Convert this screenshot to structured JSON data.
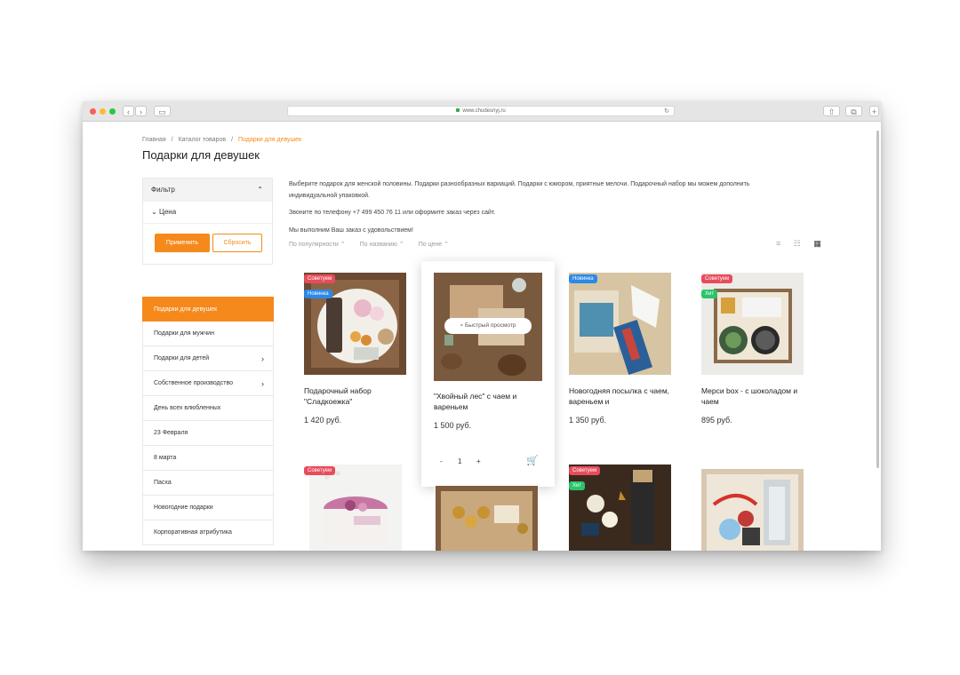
{
  "browser": {
    "url": "www.chudesnyj.ru",
    "back_glyph": "‹",
    "forward_glyph": "›",
    "sidebar_glyph": "▭",
    "reload_glyph": "↻",
    "share_glyph": "⇧",
    "tabs_glyph": "⧉",
    "newtab_glyph": "+"
  },
  "breadcrumb": {
    "items": [
      "Главная",
      "Каталог товаров",
      "Подарки для девушек"
    ],
    "separator": "/"
  },
  "page_title": "Подарки для девушек",
  "filter": {
    "title": "Фильтр",
    "collapse_glyph": "⌃",
    "price_label": "Цена",
    "price_glyph": "⌄",
    "apply_label": "Применить",
    "reset_label": "Сбросить"
  },
  "categories": [
    {
      "label": "Подарки для девушек",
      "active": true,
      "arrow": ""
    },
    {
      "label": "Подарки для мужчин",
      "active": false,
      "arrow": ""
    },
    {
      "label": "Подарки для детей",
      "active": false,
      "arrow": "›"
    },
    {
      "label": "Собственное производство",
      "active": false,
      "arrow": "›"
    },
    {
      "label": "День всех влюбленных",
      "active": false,
      "arrow": ""
    },
    {
      "label": "23 Февраля",
      "active": false,
      "arrow": ""
    },
    {
      "label": "8 марта",
      "active": false,
      "arrow": ""
    },
    {
      "label": "Пасха",
      "active": false,
      "arrow": ""
    },
    {
      "label": "Новогодние подарки",
      "active": false,
      "arrow": ""
    },
    {
      "label": "Корпоративная атрибутика",
      "active": false,
      "arrow": ""
    }
  ],
  "description": [
    "Выберите подарок для женской половины. Подарки разнообразных вариаций. Подарки с юмором, приятные мелочи. Подарочный набор мы можем дополнить индивидуальной упаковкой.",
    "Звоните по телефону +7 499 450 76 11  или оформите заказ через сайт.",
    "Мы выполним Ваш заказ с удовольствием!"
  ],
  "sort": [
    "По популярности ⌃",
    "По названию ⌃",
    "По цене ⌃"
  ],
  "view_icons": [
    "≡",
    "☷",
    "▦"
  ],
  "products": [
    {
      "title": "Подарочный набор \"Сладкоежка\"",
      "price": "1 420 руб.",
      "badges": [
        "Советуем",
        "Новинка"
      ]
    },
    {
      "title": "\"Хвойный лес\" с чаем и вареньем",
      "price": "1 500 руб.",
      "badges": [],
      "quick_view": "Быстрый просмотр",
      "qty": {
        "minus": "-",
        "value": "1",
        "plus": "+"
      },
      "cart_glyph": "🛒"
    },
    {
      "title": "Новогодняя посылка с чаем, вареньем и",
      "price": "1 350 руб.",
      "badges": [
        "Новинка"
      ]
    },
    {
      "title": "Мерси box - с шоколадом и чаем",
      "price": "895 руб.",
      "badges": [
        "Советуем",
        "Хит"
      ]
    },
    {
      "title": "",
      "price": "",
      "badges": [
        "Советуем"
      ]
    },
    {
      "title": "",
      "price": "",
      "badges": []
    },
    {
      "title": "",
      "price": "",
      "badges": [
        "Советуем",
        "Хит"
      ]
    },
    {
      "title": "",
      "price": "",
      "badges": []
    }
  ],
  "colors": {
    "accent": "#f5891c",
    "badge_recommend": "#e84c5c",
    "badge_new": "#2b89e8",
    "badge_hit": "#2cc46a"
  }
}
